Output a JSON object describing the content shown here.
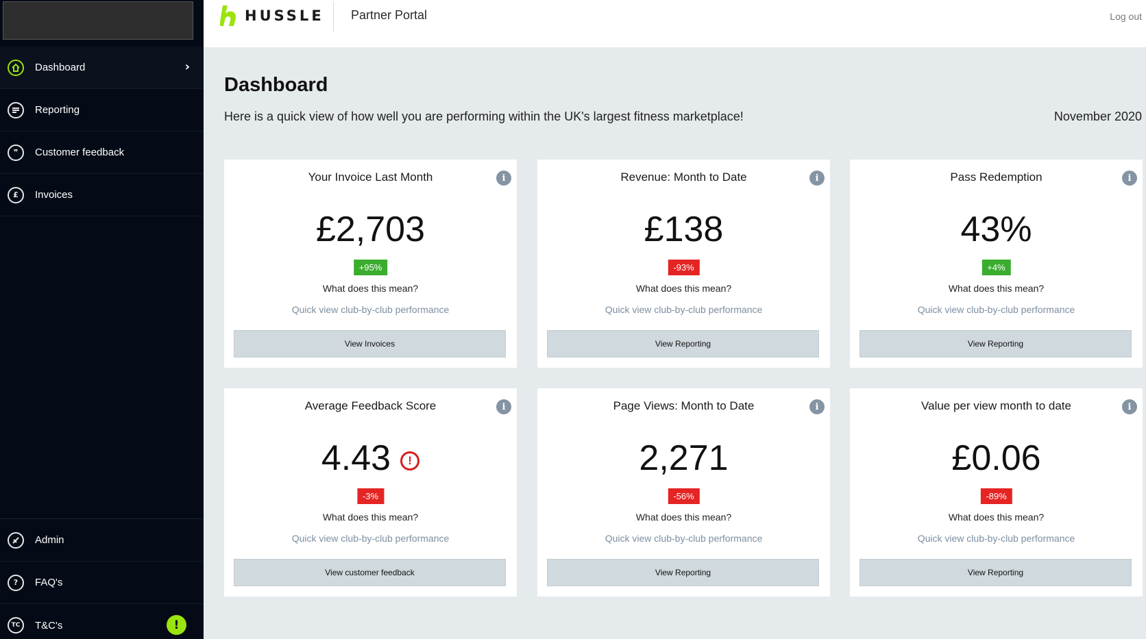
{
  "header": {
    "brand": "HUSSLE",
    "portal_title": "Partner Portal",
    "logout_label": "Log out"
  },
  "sidebar": {
    "items": [
      {
        "label": "Dashboard",
        "icon": "home-icon",
        "active": true
      },
      {
        "label": "Reporting",
        "icon": "report-icon"
      },
      {
        "label": "Customer feedback",
        "icon": "quote-icon"
      },
      {
        "label": "Invoices",
        "icon": "pound-icon"
      },
      {
        "label": "Admin",
        "icon": "admin-icon"
      },
      {
        "label": "FAQ's",
        "icon": "help-icon"
      },
      {
        "label": "T&C's",
        "icon": "tc-icon"
      }
    ],
    "tc_icon_text": "TC",
    "alert_glyph": "!"
  },
  "main": {
    "title": "Dashboard",
    "subtitle": "Here is a quick view of how well you are performing within the UK's largest fitness marketplace!",
    "period": "November 2020",
    "meaning_label": "What does this mean?",
    "quickview_label": "Quick view club-by-club performance",
    "cards": [
      {
        "title": "Your Invoice Last Month",
        "value": "£2,703",
        "change": "+95%",
        "direction": "up",
        "button": "View Invoices"
      },
      {
        "title": "Revenue: Month to Date",
        "value": "£138",
        "change": "-93%",
        "direction": "down",
        "button": "View Reporting"
      },
      {
        "title": "Pass Redemption",
        "value": "43%",
        "change": "+4%",
        "direction": "up",
        "button": "View Reporting"
      },
      {
        "title": "Average Feedback Score",
        "value": "4.43",
        "change": "-3%",
        "direction": "down",
        "button": "View customer feedback",
        "warning": true
      },
      {
        "title": "Page Views: Month to Date",
        "value": "2,271",
        "change": "-56%",
        "direction": "down",
        "button": "View Reporting"
      },
      {
        "title": "Value per view month to date",
        "value": "£0.06",
        "change": "-89%",
        "direction": "down",
        "button": "View Reporting"
      }
    ]
  },
  "colors": {
    "sidebar_bg": "#050b16",
    "accent_green": "#9be30f",
    "badge_up": "#3bad2e",
    "badge_down": "#e52424",
    "page_bg": "#e5eaec"
  }
}
